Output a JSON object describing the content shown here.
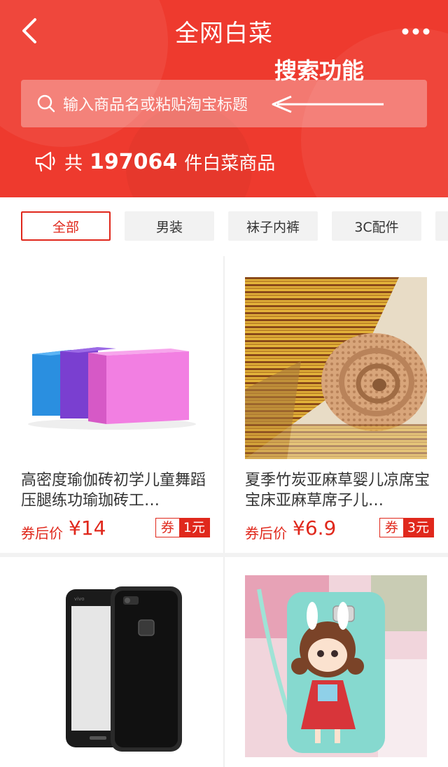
{
  "header": {
    "title": "全网白菜",
    "annotation": "搜索功能",
    "search_placeholder": "输入商品名或粘贴淘宝标题",
    "count_prefix": "共",
    "count": "197064",
    "count_suffix": "件白菜商品",
    "icons": [
      "back-arrow-icon",
      "more-dots-icon",
      "search-icon",
      "megaphone-icon"
    ]
  },
  "tabs": [
    {
      "label": "全部",
      "active": true
    },
    {
      "label": "男装",
      "active": false
    },
    {
      "label": "袜子内裤",
      "active": false
    },
    {
      "label": "3C配件",
      "active": false
    }
  ],
  "products": [
    {
      "title": "高密度瑜伽砖初学儿童舞蹈压腿练功瑜珈砖工…",
      "price_label": "券后价",
      "price": "¥14",
      "coupon_label": "券",
      "coupon_value": "1元"
    },
    {
      "title": "夏季竹炭亚麻草婴儿凉席宝宝床亚麻草席子儿…",
      "price_label": "券后价",
      "price": "¥6.9",
      "coupon_label": "券",
      "coupon_value": "3元"
    },
    {
      "title": "",
      "price_label": "",
      "price": "",
      "coupon_label": "",
      "coupon_value": ""
    },
    {
      "title": "",
      "price_label": "",
      "price": "",
      "coupon_label": "",
      "coupon_value": ""
    }
  ],
  "colors": {
    "header_red": "#ee3a2e",
    "accent_red": "#e0281c"
  }
}
